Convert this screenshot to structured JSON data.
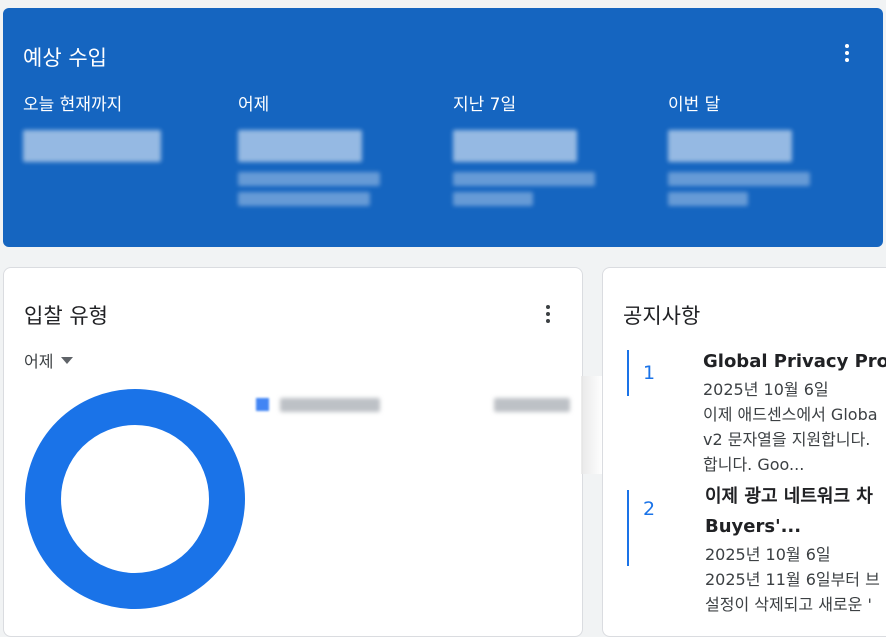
{
  "earnings": {
    "title": "예상 수입",
    "periods": [
      {
        "label": "오늘 현재까지"
      },
      {
        "label": "어제"
      },
      {
        "label": "지난 7일"
      },
      {
        "label": "이번 달"
      }
    ]
  },
  "bid_types": {
    "title": "입찰 유형",
    "range_label": "어제",
    "chart_color": "#1a73e8"
  },
  "notices": {
    "title": "공지사항",
    "items": [
      {
        "number": "1",
        "title": "Global Privacy Proto",
        "date": "2025년 10월 6일",
        "snippet_lines": [
          "이제 애드센스에서 Globa",
          "v2 문자열을 지원합니다.",
          "합니다. Goo..."
        ]
      },
      {
        "number": "2",
        "title_lines": [
          "이제 광고 네트워크 차",
          "Buyers'..."
        ],
        "date": "2025년 10월 6일",
        "snippet_lines": [
          "2025년 11월 6일부터 브",
          "설정이 삭제되고 새로운 '"
        ]
      }
    ]
  }
}
